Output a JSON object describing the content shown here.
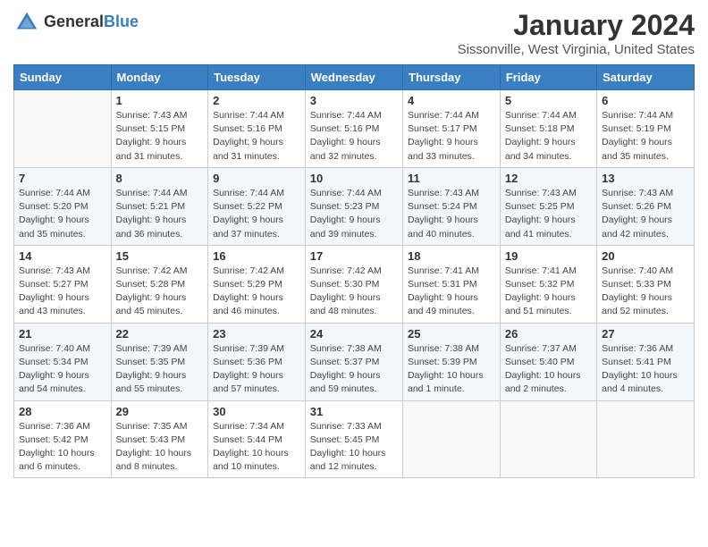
{
  "header": {
    "logo_general": "General",
    "logo_blue": "Blue",
    "month_title": "January 2024",
    "location": "Sissonville, West Virginia, United States"
  },
  "days_of_week": [
    "Sunday",
    "Monday",
    "Tuesday",
    "Wednesday",
    "Thursday",
    "Friday",
    "Saturday"
  ],
  "weeks": [
    [
      {
        "day": "",
        "empty": true
      },
      {
        "day": "1",
        "sunrise": "Sunrise: 7:43 AM",
        "sunset": "Sunset: 5:15 PM",
        "daylight": "Daylight: 9 hours and 31 minutes."
      },
      {
        "day": "2",
        "sunrise": "Sunrise: 7:44 AM",
        "sunset": "Sunset: 5:16 PM",
        "daylight": "Daylight: 9 hours and 31 minutes."
      },
      {
        "day": "3",
        "sunrise": "Sunrise: 7:44 AM",
        "sunset": "Sunset: 5:16 PM",
        "daylight": "Daylight: 9 hours and 32 minutes."
      },
      {
        "day": "4",
        "sunrise": "Sunrise: 7:44 AM",
        "sunset": "Sunset: 5:17 PM",
        "daylight": "Daylight: 9 hours and 33 minutes."
      },
      {
        "day": "5",
        "sunrise": "Sunrise: 7:44 AM",
        "sunset": "Sunset: 5:18 PM",
        "daylight": "Daylight: 9 hours and 34 minutes."
      },
      {
        "day": "6",
        "sunrise": "Sunrise: 7:44 AM",
        "sunset": "Sunset: 5:19 PM",
        "daylight": "Daylight: 9 hours and 35 minutes."
      }
    ],
    [
      {
        "day": "7",
        "sunrise": "Sunrise: 7:44 AM",
        "sunset": "Sunset: 5:20 PM",
        "daylight": "Daylight: 9 hours and 35 minutes."
      },
      {
        "day": "8",
        "sunrise": "Sunrise: 7:44 AM",
        "sunset": "Sunset: 5:21 PM",
        "daylight": "Daylight: 9 hours and 36 minutes."
      },
      {
        "day": "9",
        "sunrise": "Sunrise: 7:44 AM",
        "sunset": "Sunset: 5:22 PM",
        "daylight": "Daylight: 9 hours and 37 minutes."
      },
      {
        "day": "10",
        "sunrise": "Sunrise: 7:44 AM",
        "sunset": "Sunset: 5:23 PM",
        "daylight": "Daylight: 9 hours and 39 minutes."
      },
      {
        "day": "11",
        "sunrise": "Sunrise: 7:43 AM",
        "sunset": "Sunset: 5:24 PM",
        "daylight": "Daylight: 9 hours and 40 minutes."
      },
      {
        "day": "12",
        "sunrise": "Sunrise: 7:43 AM",
        "sunset": "Sunset: 5:25 PM",
        "daylight": "Daylight: 9 hours and 41 minutes."
      },
      {
        "day": "13",
        "sunrise": "Sunrise: 7:43 AM",
        "sunset": "Sunset: 5:26 PM",
        "daylight": "Daylight: 9 hours and 42 minutes."
      }
    ],
    [
      {
        "day": "14",
        "sunrise": "Sunrise: 7:43 AM",
        "sunset": "Sunset: 5:27 PM",
        "daylight": "Daylight: 9 hours and 43 minutes."
      },
      {
        "day": "15",
        "sunrise": "Sunrise: 7:42 AM",
        "sunset": "Sunset: 5:28 PM",
        "daylight": "Daylight: 9 hours and 45 minutes."
      },
      {
        "day": "16",
        "sunrise": "Sunrise: 7:42 AM",
        "sunset": "Sunset: 5:29 PM",
        "daylight": "Daylight: 9 hours and 46 minutes."
      },
      {
        "day": "17",
        "sunrise": "Sunrise: 7:42 AM",
        "sunset": "Sunset: 5:30 PM",
        "daylight": "Daylight: 9 hours and 48 minutes."
      },
      {
        "day": "18",
        "sunrise": "Sunrise: 7:41 AM",
        "sunset": "Sunset: 5:31 PM",
        "daylight": "Daylight: 9 hours and 49 minutes."
      },
      {
        "day": "19",
        "sunrise": "Sunrise: 7:41 AM",
        "sunset": "Sunset: 5:32 PM",
        "daylight": "Daylight: 9 hours and 51 minutes."
      },
      {
        "day": "20",
        "sunrise": "Sunrise: 7:40 AM",
        "sunset": "Sunset: 5:33 PM",
        "daylight": "Daylight: 9 hours and 52 minutes."
      }
    ],
    [
      {
        "day": "21",
        "sunrise": "Sunrise: 7:40 AM",
        "sunset": "Sunset: 5:34 PM",
        "daylight": "Daylight: 9 hours and 54 minutes."
      },
      {
        "day": "22",
        "sunrise": "Sunrise: 7:39 AM",
        "sunset": "Sunset: 5:35 PM",
        "daylight": "Daylight: 9 hours and 55 minutes."
      },
      {
        "day": "23",
        "sunrise": "Sunrise: 7:39 AM",
        "sunset": "Sunset: 5:36 PM",
        "daylight": "Daylight: 9 hours and 57 minutes."
      },
      {
        "day": "24",
        "sunrise": "Sunrise: 7:38 AM",
        "sunset": "Sunset: 5:37 PM",
        "daylight": "Daylight: 9 hours and 59 minutes."
      },
      {
        "day": "25",
        "sunrise": "Sunrise: 7:38 AM",
        "sunset": "Sunset: 5:39 PM",
        "daylight": "Daylight: 10 hours and 1 minute."
      },
      {
        "day": "26",
        "sunrise": "Sunrise: 7:37 AM",
        "sunset": "Sunset: 5:40 PM",
        "daylight": "Daylight: 10 hours and 2 minutes."
      },
      {
        "day": "27",
        "sunrise": "Sunrise: 7:36 AM",
        "sunset": "Sunset: 5:41 PM",
        "daylight": "Daylight: 10 hours and 4 minutes."
      }
    ],
    [
      {
        "day": "28",
        "sunrise": "Sunrise: 7:36 AM",
        "sunset": "Sunset: 5:42 PM",
        "daylight": "Daylight: 10 hours and 6 minutes."
      },
      {
        "day": "29",
        "sunrise": "Sunrise: 7:35 AM",
        "sunset": "Sunset: 5:43 PM",
        "daylight": "Daylight: 10 hours and 8 minutes."
      },
      {
        "day": "30",
        "sunrise": "Sunrise: 7:34 AM",
        "sunset": "Sunset: 5:44 PM",
        "daylight": "Daylight: 10 hours and 10 minutes."
      },
      {
        "day": "31",
        "sunrise": "Sunrise: 7:33 AM",
        "sunset": "Sunset: 5:45 PM",
        "daylight": "Daylight: 10 hours and 12 minutes."
      },
      {
        "day": "",
        "empty": true
      },
      {
        "day": "",
        "empty": true
      },
      {
        "day": "",
        "empty": true
      }
    ]
  ]
}
